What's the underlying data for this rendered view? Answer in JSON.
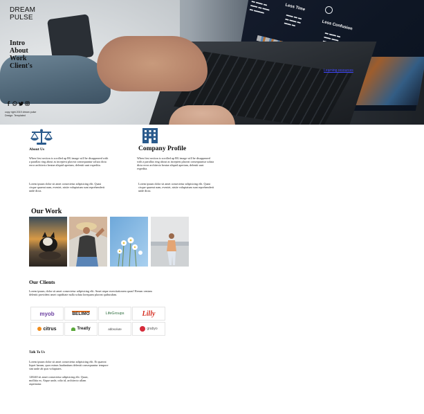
{
  "brand": {
    "line1": "DREAM",
    "line2": "PULSE"
  },
  "nav": {
    "items": [
      "Intro",
      "About",
      "Work",
      "Client's"
    ]
  },
  "social": [
    "facebook-icon",
    "whatsapp-icon",
    "twitter-icon",
    "instagram-icon"
  ],
  "copyright": {
    "line1": "copy right 2019 dream pulse",
    "line2": "Design: Templated"
  },
  "hero_screen": {
    "heading1": "Less Time",
    "heading2": "Less Confusion",
    "link": "Learning resources"
  },
  "about": {
    "title": "About Us",
    "para1": "When first section is scrolled up BG image will be disappeared with a parallax ring about as inceptest placeat consequuntur soluta dicta error architecto beatae aliquid aperiam, deleniti sunt expedita.",
    "para2": "Lorem ipsum dolor sit amet consectetur adipisicing elit. Quasi cisque quaerat nam, eveniet, nisite voluptatum sunt reprehenderit unde dicta."
  },
  "company": {
    "title": "Company Profile",
    "para1": "When first section is scrolled up BG image will be disappeared with a parallax ring about as inceptest placeat consequuntur soluta dicta error architecto beatae aliquid aperiam, deleniti sunt expedita.",
    "para2": "Lorem ipsum dolor sit amet consectetur adipisicing elit. Quasi cisque quaerat nam, eveniet, nisite voluptatum sunt reprehenderit unde dicta."
  },
  "work": {
    "title": "Our Work"
  },
  "clients": {
    "title": "Our Clients",
    "para": "Lorem ipsum, dolor sit amet consectetur adipisicing elit. Amet atque exercitationem quasi! Rerum veniam deleniti provident amet cupiditate nulla soluta lorequam placeat quibusdam.",
    "logos": [
      "myob",
      "BELIMO",
      "LifeGroups",
      "Lilly",
      "citrus",
      "Treatly",
      "abbsolute",
      "grabyo"
    ]
  },
  "talk": {
    "title": "Talk To Us",
    "para1": "Lorem ipsum dolor sit amet consectetur adipisicing elit. Et quaerat liquet harum, quos minus laudantium deleniti consequuntur tempore sint unde ab quis voluptates.",
    "para2": "120240 sit amet consectetur adipisicing elit. Quasi, mollitia ex. Atque unde, odio id, architecto ullam aspernatur."
  }
}
